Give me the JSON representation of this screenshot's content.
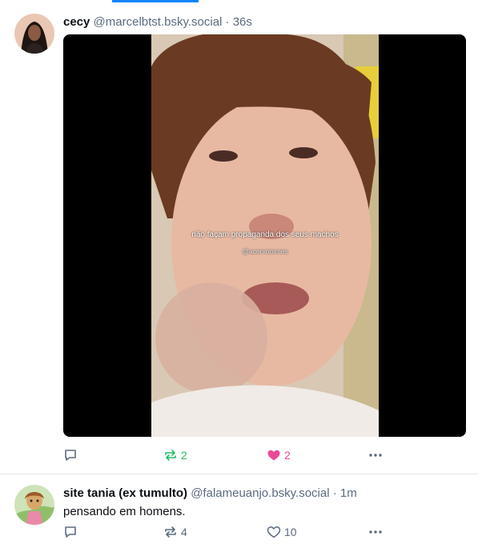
{
  "posts": [
    {
      "display_name": "cecy",
      "handle": "@marcelbtst.bsky.social",
      "separator": "·",
      "time": "36s",
      "video": {
        "caption": "não façam propaganda dos seus machos",
        "watermark": "@acervommes"
      },
      "actions": {
        "reply_count": "",
        "repost_count": "2",
        "like_count": "2"
      },
      "reposted": true,
      "liked": true
    },
    {
      "display_name": "site tania (ex tumulto)",
      "handle": "@falameuanjo.bsky.social",
      "separator": "·",
      "time": "1m",
      "text": "pensando em homens.",
      "actions": {
        "reply_count": "",
        "repost_count": "4",
        "like_count": "10"
      },
      "reposted": false,
      "liked": false
    }
  ],
  "colors": {
    "accent": "#1083fe",
    "repost_active": "#20bc67",
    "like_active": "#ec4899",
    "muted": "#5b6b7f"
  }
}
